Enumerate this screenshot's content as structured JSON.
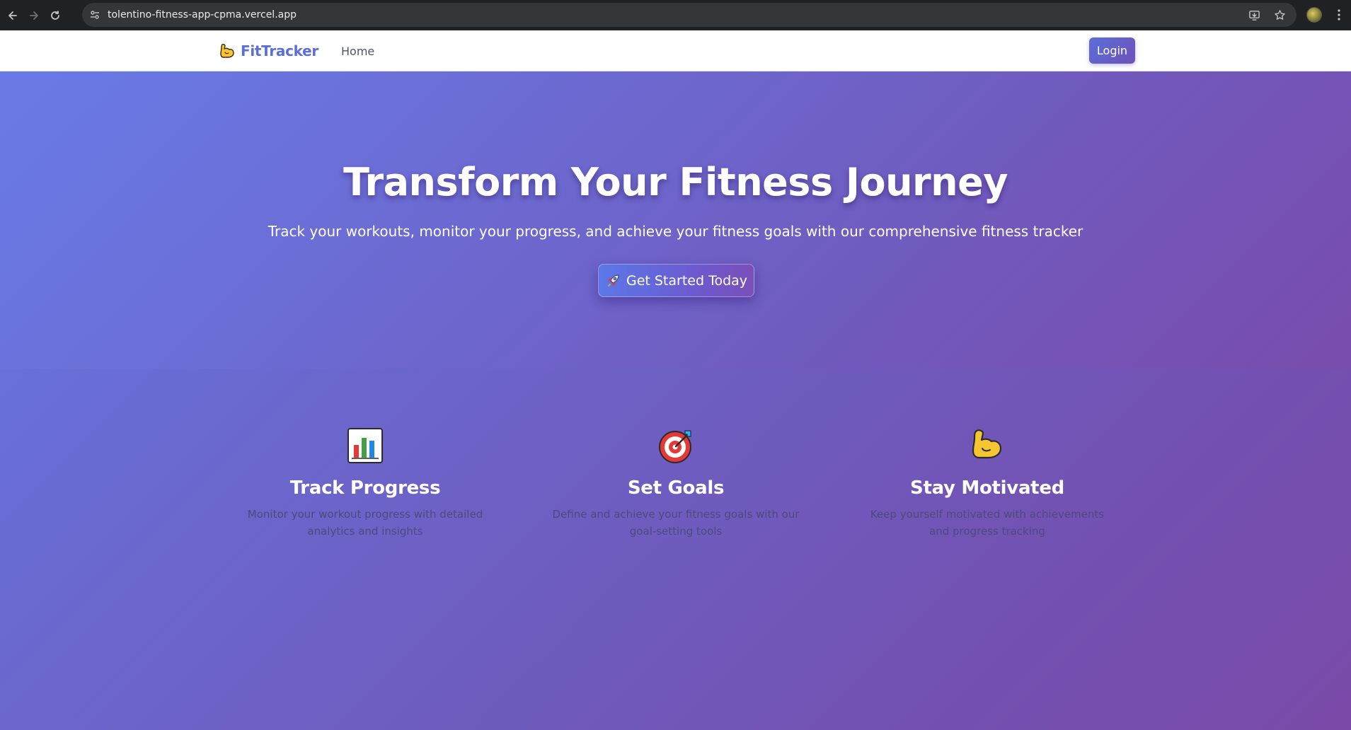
{
  "browser": {
    "url": "tolentino-fitness-app-cpma.vercel.app"
  },
  "navbar": {
    "brand": "FitTracker",
    "home_link": "Home",
    "login_button": "Login"
  },
  "hero": {
    "title": "Transform Your Fitness Journey",
    "subtitle": "Track your workouts, monitor your progress, and achieve your fitness goals with our comprehensive fitness tracker",
    "cta_label": "Get Started Today",
    "cta_icon": "rocket-icon"
  },
  "features": [
    {
      "icon": "bar-chart-icon",
      "title": "Track Progress",
      "description": "Monitor your workout progress with detailed analytics and insights"
    },
    {
      "icon": "target-icon",
      "title": "Set Goals",
      "description": "Define and achieve your fitness goals with our goal-setting tools"
    },
    {
      "icon": "flexed-biceps-icon",
      "title": "Stay Motivated",
      "description": "Keep yourself motivated with achievements and progress tracking"
    }
  ],
  "colors": {
    "brand": "#5b6fd6",
    "gradient_start": "#6679e4",
    "gradient_end": "#7a4aa8"
  }
}
